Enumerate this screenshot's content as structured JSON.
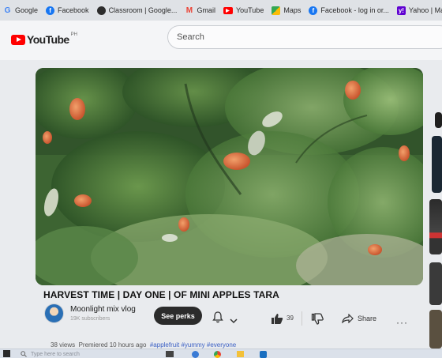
{
  "bookmarks": [
    {
      "label": "Google",
      "icon": "google-icon",
      "color": "#4285f4"
    },
    {
      "label": "Facebook",
      "icon": "facebook-icon",
      "color": "#1877f2"
    },
    {
      "label": "Classroom | Google...",
      "icon": "classroom-icon",
      "color": "#2d2d2d"
    },
    {
      "label": "Gmail",
      "icon": "gmail-icon",
      "color": "#ea4335"
    },
    {
      "label": "YouTube",
      "icon": "youtube-icon",
      "color": "#ff0000"
    },
    {
      "label": "Maps",
      "icon": "maps-icon",
      "color": "#34a853"
    },
    {
      "label": "Facebook - log in or...",
      "icon": "facebook-icon",
      "color": "#1877f2"
    },
    {
      "label": "Yahoo | Ma",
      "icon": "yahoo-icon",
      "color": "#5f01d1"
    }
  ],
  "header": {
    "logo_text": "YouTube",
    "country_code": "PH",
    "search_placeholder": "Search"
  },
  "video": {
    "title": "HARVEST TIME | DAY ONE | OF MINI APPLES TARA",
    "channel_name": "Moonlight mix vlog",
    "subscribers": "19K subscribers",
    "perks_label": "See perks",
    "like_count": "39",
    "share_label": "Share",
    "more_label": "···",
    "views": "38 views",
    "premiered": "Premiered 10 hours ago",
    "hashtags": "#applefruit #yummy #everyone"
  },
  "taskbar": {
    "search_placeholder": "Type here to search"
  },
  "colors": {
    "accent": "#ff0000",
    "perks_bg": "#2b2b2b",
    "hashtag": "#3a5fc4"
  }
}
